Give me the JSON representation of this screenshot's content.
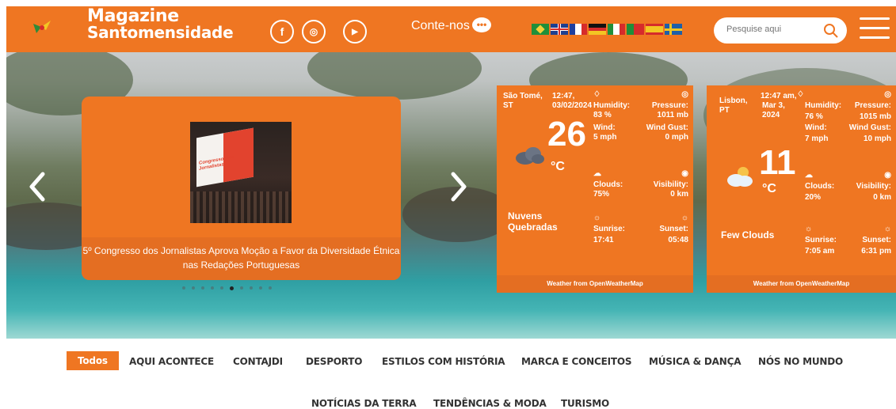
{
  "header": {
    "brand_line1": "Magazine",
    "brand_line2": "Santomensidade",
    "social": [
      {
        "name": "facebook-icon",
        "glyph": "f"
      },
      {
        "name": "instagram-icon",
        "glyph": "◎"
      },
      {
        "name": "youtube-icon",
        "glyph": "▶"
      }
    ],
    "contact_label": "Conte-nos",
    "contact_bubble": "•••",
    "search_placeholder": "Pesquise aqui",
    "accent": "#ef7622"
  },
  "slider": {
    "caption": "5º Congresso dos Jornalistas Aprova Moção a Favor da Diversidade Étnica nas Redações Portuguesas",
    "image_text": "Congresso Dos Jornalistas",
    "dots_count": 10,
    "active_dot": 5
  },
  "weather": [
    {
      "location": "São Tomé, ST",
      "time": "12:47,",
      "date": "03/02/2024",
      "temp": "26",
      "unit": "°C",
      "condition": "Nuvens Quebradas",
      "humidity_label": "Humidity:",
      "humidity": "83 %",
      "pressure_label": "Pressure:",
      "pressure": "1011 mb",
      "wind_label": "Wind:",
      "wind": "5 mph",
      "gust_label": "Wind Gust:",
      "gust": "0 mph",
      "clouds_label": "Clouds:",
      "clouds": "75%",
      "visibility_label": "Visibility:",
      "visibility": "0 km",
      "sunrise_label": "Sunrise:",
      "sunrise": "17:41",
      "sunset_label": "Sunset:",
      "sunset": "05:48",
      "footer": "Weather from OpenWeatherMap"
    },
    {
      "location": "Lisbon, PT",
      "time": "12:47 am,",
      "date": "Mar 3, 2024",
      "temp": "11",
      "unit": "°C",
      "condition": "Few Clouds",
      "humidity_label": "Humidity:",
      "humidity": "76 %",
      "pressure_label": "Pressure:",
      "pressure": "1015 mb",
      "wind_label": "Wind:",
      "wind": "7 mph",
      "gust_label": "Wind Gust:",
      "gust": "10 mph",
      "clouds_label": "Clouds:",
      "clouds": "20%",
      "visibility_label": "Visibility:",
      "visibility": "0 km",
      "sunrise_label": "Sunrise:",
      "sunrise": "7:05 am",
      "sunset_label": "Sunset:",
      "sunset": "6:31 pm",
      "footer": "Weather from OpenWeatherMap"
    }
  ],
  "categories": [
    "Todos",
    "AQUI ACONTECE",
    "CONTAJDI",
    "DESPORTO",
    "ESTILOS COM HISTÓRIA",
    "MARCA E CONCEITOS",
    "MÚSICA & DANÇA",
    "NÓS NO MUNDO",
    "NOTÍCIAS DA TERRA",
    "TENDÊNCIAS & MODA",
    "TURISMO"
  ]
}
